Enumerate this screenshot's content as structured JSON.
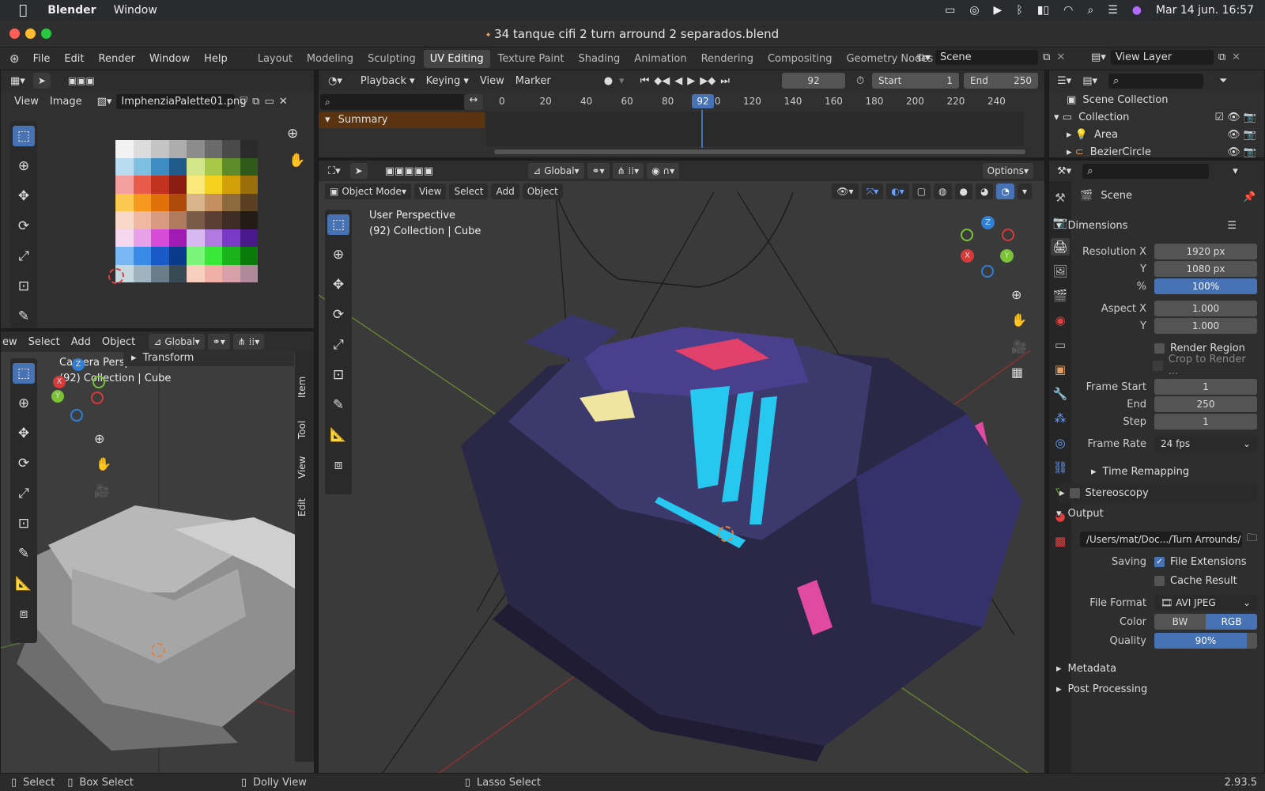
{
  "mac_menubar": {
    "app_name": "Blender",
    "menu_window": "Window",
    "datetime": "Mar 14 jun.  16:57"
  },
  "window": {
    "title": "34 tanque cifi 2 turn arround 2 separados.blend"
  },
  "topbar": {
    "menus": [
      "File",
      "Edit",
      "Render",
      "Window",
      "Help"
    ],
    "workspaces": [
      "Layout",
      "Modeling",
      "Sculpting",
      "UV Editing",
      "Texture Paint",
      "Shading",
      "Animation",
      "Rendering",
      "Compositing",
      "Geometry Nodes",
      "S"
    ],
    "active_workspace": "UV Editing",
    "scene_name": "Scene",
    "view_layer": "View Layer"
  },
  "image_editor": {
    "menus": [
      "View",
      "Image"
    ],
    "image_name": "ImphenziaPalette01.png",
    "palette_colors": [
      "#f2f2f2",
      "#dcdcdc",
      "#c4c4c4",
      "#adadad",
      "#8c8c8c",
      "#6a6a6a",
      "#4a4a4a",
      "#2a2a2a",
      "#b9dcf0",
      "#7fbfe0",
      "#3d8cc4",
      "#1f5a8a",
      "#d4e68a",
      "#a8c84a",
      "#5e8c2a",
      "#2f5a1a",
      "#f5a0a0",
      "#e85a4a",
      "#c0321e",
      "#8a1c12",
      "#fbe87a",
      "#f5d21e",
      "#d4a00a",
      "#9a6e0a",
      "#fbc850",
      "#f59a1e",
      "#e0700a",
      "#b04a0a",
      "#d9b48a",
      "#c49060",
      "#8c6a3e",
      "#5a4020",
      "#f8d8c8",
      "#f0b8a0",
      "#d89a80",
      "#b07a60",
      "#7a5a48",
      "#5a4034",
      "#3e2c24",
      "#241a16",
      "#f5d8f0",
      "#e8a0e8",
      "#d84ad8",
      "#a01ab4",
      "#d8b8f0",
      "#b07ae0",
      "#7a3ac8",
      "#4a1a8a",
      "#7ab8f5",
      "#3a8ae8",
      "#1a5ac8",
      "#0a3a8a",
      "#7af57a",
      "#3ae83a",
      "#1ab41a",
      "#0a7a0a",
      "#c8d8e0",
      "#a0b4c0",
      "#6a7e8a",
      "#3a4a54",
      "#f8d0c0",
      "#f0b0a8",
      "#d8a0a8",
      "#b08a9a"
    ]
  },
  "timeline": {
    "menus": [
      "Playback",
      "Keying",
      "View",
      "Marker"
    ],
    "current_frame": "92",
    "start_label": "Start",
    "start": "1",
    "end_label": "End",
    "end": "250",
    "summary": "Summary",
    "ruler_ticks": [
      "0",
      "20",
      "40",
      "60",
      "80",
      "100",
      "120",
      "140",
      "160",
      "180",
      "200",
      "220",
      "240"
    ]
  },
  "left_viewport": {
    "menus": [
      "ew",
      "Select",
      "Add",
      "Object"
    ],
    "orientation": "Global",
    "overlay_line1": "Camera Perspective",
    "overlay_line2": "(92) Collection | Cube",
    "transform_label": "Transform",
    "side_tabs": [
      "Item",
      "Tool",
      "View",
      "Edit"
    ]
  },
  "main_viewport": {
    "orientation": "Global",
    "options": "Options",
    "mode": "Object Mode",
    "menus": [
      "View",
      "Select",
      "Add",
      "Object"
    ],
    "overlay_line1": "User Perspective",
    "overlay_line2": "(92) Collection | Cube",
    "gizmo": {
      "z": "Z",
      "y": "Y",
      "x": "X"
    }
  },
  "outliner": {
    "root": "Scene Collection",
    "items": [
      "Collection",
      "Area",
      "BezierCircle"
    ]
  },
  "properties": {
    "context": "Scene",
    "dimensions_label": "Dimensions",
    "resolution_x_label": "Resolution X",
    "resolution_x": "1920 px",
    "y_label": "Y",
    "resolution_y": "1080 px",
    "percent_label": "%",
    "percent": "100%",
    "aspect_x_label": "Aspect X",
    "aspect_x": "1.000",
    "aspect_y": "1.000",
    "render_region": "Render Region",
    "crop_region": "Crop to Render ...",
    "frame_start_label": "Frame Start",
    "frame_start": "1",
    "end_label": "End",
    "frame_end": "250",
    "step_label": "Step",
    "frame_step": "1",
    "frame_rate_label": "Frame Rate",
    "frame_rate": "24 fps",
    "time_remapping": "Time Remapping",
    "stereoscopy": "Stereoscopy",
    "output_label": "Output",
    "output_path": "/Users/mat/Doc.../Turn Arrounds/",
    "saving_label": "Saving",
    "file_extensions": "File Extensions",
    "cache_result": "Cache Result",
    "file_format_label": "File Format",
    "file_format": "AVI JPEG",
    "color_label": "Color",
    "color_bw": "BW",
    "color_rgb": "RGB",
    "quality_label": "Quality",
    "quality": "90%",
    "quality_fraction": 0.9,
    "metadata": "Metadata",
    "post_processing": "Post Processing"
  },
  "statusbar": {
    "select": "Select",
    "box_select": "Box Select",
    "dolly_view": "Dolly View",
    "lasso_select": "Lasso Select",
    "version": "2.93.5"
  }
}
